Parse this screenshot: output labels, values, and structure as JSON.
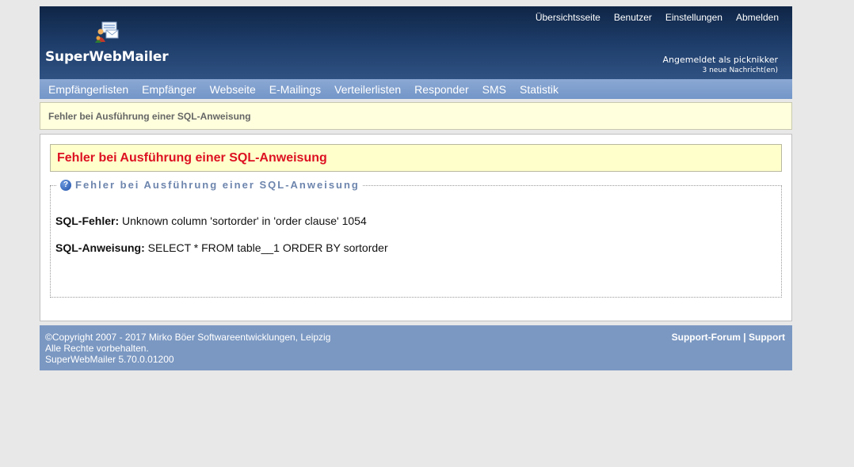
{
  "header": {
    "brand": "SuperWebMailer",
    "top_links": [
      "Übersichtsseite",
      "Benutzer",
      "Einstellungen",
      "Abmelden"
    ],
    "login_text": "Angemeldet als picknikker",
    "messages_text": "3 neue Nachricht(en)"
  },
  "nav": {
    "items": [
      "Empfängerlisten",
      "Empfänger",
      "Webseite",
      "E-Mailings",
      "Verteilerlisten",
      "Responder",
      "SMS",
      "Statistik"
    ]
  },
  "page_title": "Fehler bei Ausführung einer SQL-Anweisung",
  "error_box": {
    "title": "Fehler bei Ausführung einer SQL-Anweisung"
  },
  "fieldset": {
    "legend": "Fehler bei Ausführung einer SQL-Anweisung",
    "sql_error_label": "SQL-Fehler:",
    "sql_error_value": "Unknown column 'sortorder' in 'order clause' 1054",
    "sql_statement_label": "SQL-Anweisung:",
    "sql_statement_value": "SELECT * FROM table__1 ORDER BY sortorder"
  },
  "footer": {
    "copyright": "©Copyright 2007 - 2017 Mirko Böer Softwareentwicklungen, Leipzig",
    "rights": "Alle Rechte vorbehalten.",
    "version": "SuperWebMailer 5.70.0.01200",
    "support_forum": "Support-Forum",
    "separator": "|",
    "support": "Support"
  },
  "colors": {
    "header_dark": "#0f2545",
    "nav": "#7b9bcb",
    "error_text": "#dd1122",
    "legend_text": "#6d85ad",
    "footer": "#7b98c2"
  }
}
